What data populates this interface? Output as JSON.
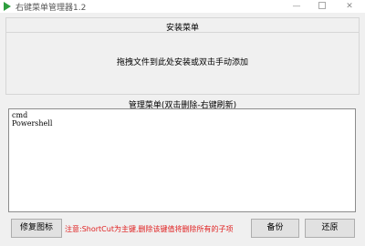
{
  "window": {
    "title": "右键菜单管理器1.2",
    "min_glyph": "—",
    "close_glyph": "✕"
  },
  "install": {
    "title": "安装菜单",
    "hint": "拖拽文件到此处安装或双击手动添加"
  },
  "manage": {
    "label": "管理菜单(双击删除-右键刷新)",
    "items": [
      "cmd",
      "Powershell"
    ]
  },
  "buttons": {
    "repair": "修复图标",
    "backup": "备份",
    "restore": "还原"
  },
  "note": "注意:ShortCut为主键,删除该键值将删除所有的子项",
  "colors": {
    "accent": "#2e9e3e",
    "warning": "#e02020"
  }
}
